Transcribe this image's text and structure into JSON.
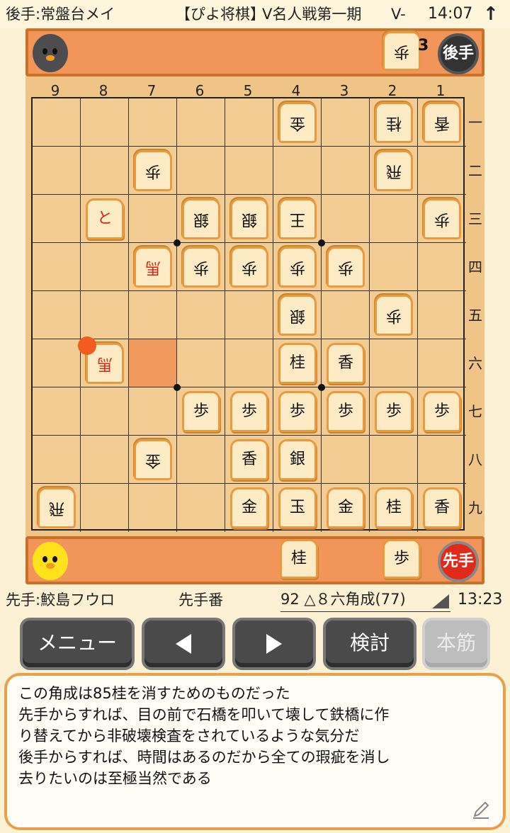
{
  "header": {
    "gote_player": "後手:常盤台メイ",
    "app_title": "【ぴよ将棋】",
    "event": "V名人戦第一期",
    "event_more": "V-",
    "clock": "14:07",
    "arrow": "↑"
  },
  "gote_stand": {
    "avatar": "gray-chick-icon",
    "badge": "後手",
    "hand": [
      {
        "piece": "歩",
        "count": "3"
      }
    ]
  },
  "sente_stand": {
    "avatar": "yellow-chick-icon",
    "badge": "先手",
    "hand": [
      {
        "piece": "桂"
      },
      {
        "piece": "歩"
      }
    ]
  },
  "board": {
    "files": [
      "9",
      "8",
      "7",
      "6",
      "5",
      "4",
      "3",
      "2",
      "1"
    ],
    "ranks": [
      "一",
      "二",
      "三",
      "四",
      "五",
      "六",
      "七",
      "八",
      "九"
    ],
    "last_move_square": "76",
    "hint_square": "86",
    "pieces": [
      {
        "sq": "41",
        "owner": "gote",
        "kind": "金"
      },
      {
        "sq": "21",
        "owner": "gote",
        "kind": "桂"
      },
      {
        "sq": "11",
        "owner": "gote",
        "kind": "香"
      },
      {
        "sq": "72",
        "owner": "gote",
        "kind": "歩"
      },
      {
        "sq": "22",
        "owner": "gote",
        "kind": "飛"
      },
      {
        "sq": "83",
        "owner": "sente",
        "kind": "と",
        "promoted": true
      },
      {
        "sq": "63",
        "owner": "gote",
        "kind": "銀"
      },
      {
        "sq": "53",
        "owner": "gote",
        "kind": "銀"
      },
      {
        "sq": "43",
        "owner": "gote",
        "kind": "王"
      },
      {
        "sq": "13",
        "owner": "gote",
        "kind": "歩"
      },
      {
        "sq": "74",
        "owner": "gote",
        "kind": "馬",
        "promoted": true
      },
      {
        "sq": "64",
        "owner": "gote",
        "kind": "歩"
      },
      {
        "sq": "54",
        "owner": "gote",
        "kind": "歩"
      },
      {
        "sq": "44",
        "owner": "gote",
        "kind": "歩"
      },
      {
        "sq": "34",
        "owner": "gote",
        "kind": "歩"
      },
      {
        "sq": "45",
        "owner": "gote",
        "kind": "銀"
      },
      {
        "sq": "25",
        "owner": "gote",
        "kind": "歩"
      },
      {
        "sq": "86",
        "owner": "gote",
        "kind": "馬",
        "promoted": true
      },
      {
        "sq": "46",
        "owner": "sente",
        "kind": "桂"
      },
      {
        "sq": "36",
        "owner": "sente",
        "kind": "香"
      },
      {
        "sq": "67",
        "owner": "sente",
        "kind": "歩"
      },
      {
        "sq": "57",
        "owner": "sente",
        "kind": "歩"
      },
      {
        "sq": "47",
        "owner": "sente",
        "kind": "歩"
      },
      {
        "sq": "37",
        "owner": "sente",
        "kind": "歩"
      },
      {
        "sq": "27",
        "owner": "sente",
        "kind": "歩"
      },
      {
        "sq": "17",
        "owner": "sente",
        "kind": "歩"
      },
      {
        "sq": "78",
        "owner": "gote",
        "kind": "金"
      },
      {
        "sq": "58",
        "owner": "sente",
        "kind": "香"
      },
      {
        "sq": "48",
        "owner": "sente",
        "kind": "銀"
      },
      {
        "sq": "99",
        "owner": "gote",
        "kind": "飛"
      },
      {
        "sq": "59",
        "owner": "sente",
        "kind": "金"
      },
      {
        "sq": "49",
        "owner": "sente",
        "kind": "玉"
      },
      {
        "sq": "39",
        "owner": "sente",
        "kind": "金"
      },
      {
        "sq": "29",
        "owner": "sente",
        "kind": "桂"
      },
      {
        "sq": "19",
        "owner": "sente",
        "kind": "香"
      }
    ]
  },
  "status": {
    "sente_player": "先手:鮫島フウロ",
    "turn": "先手番",
    "last_move": "92 △８六角成(77)",
    "clock": "13:23"
  },
  "buttons": {
    "menu": "メニュー",
    "back": "◀",
    "forward": "▶",
    "analyze": "検討",
    "mainline": "本筋"
  },
  "comment": {
    "lines": [
      "この角成は85桂を消すためのものだった",
      "先手からすれば、目の前で石橋を叩いて壊して鉄橋に作",
      "り替えてから非破壊検査をされているような気分だ",
      "後手からすれば、時間はあるのだから全ての瑕疵を消し",
      "去りたいのは至極当然である"
    ],
    "edit_icon": "pencil-icon"
  }
}
